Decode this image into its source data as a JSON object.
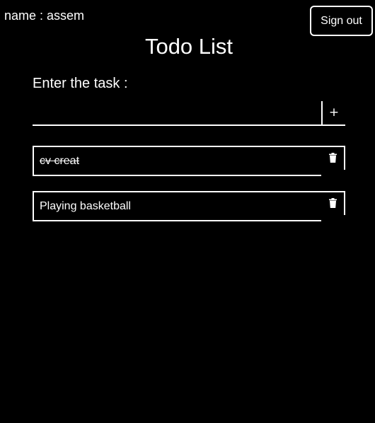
{
  "header": {
    "user_label": "name : assem",
    "signout_label": "Sign out"
  },
  "title": "Todo List",
  "form": {
    "label": "Enter the task :",
    "input_value": "",
    "add_label": "+"
  },
  "tasks": [
    {
      "text": "cv creat",
      "completed": true,
      "delete_icon": "trash-icon"
    },
    {
      "text": "Playing basketball",
      "completed": false,
      "delete_icon": "trash-icon"
    }
  ],
  "colors": {
    "background": "#000000",
    "foreground": "#ffffff"
  }
}
